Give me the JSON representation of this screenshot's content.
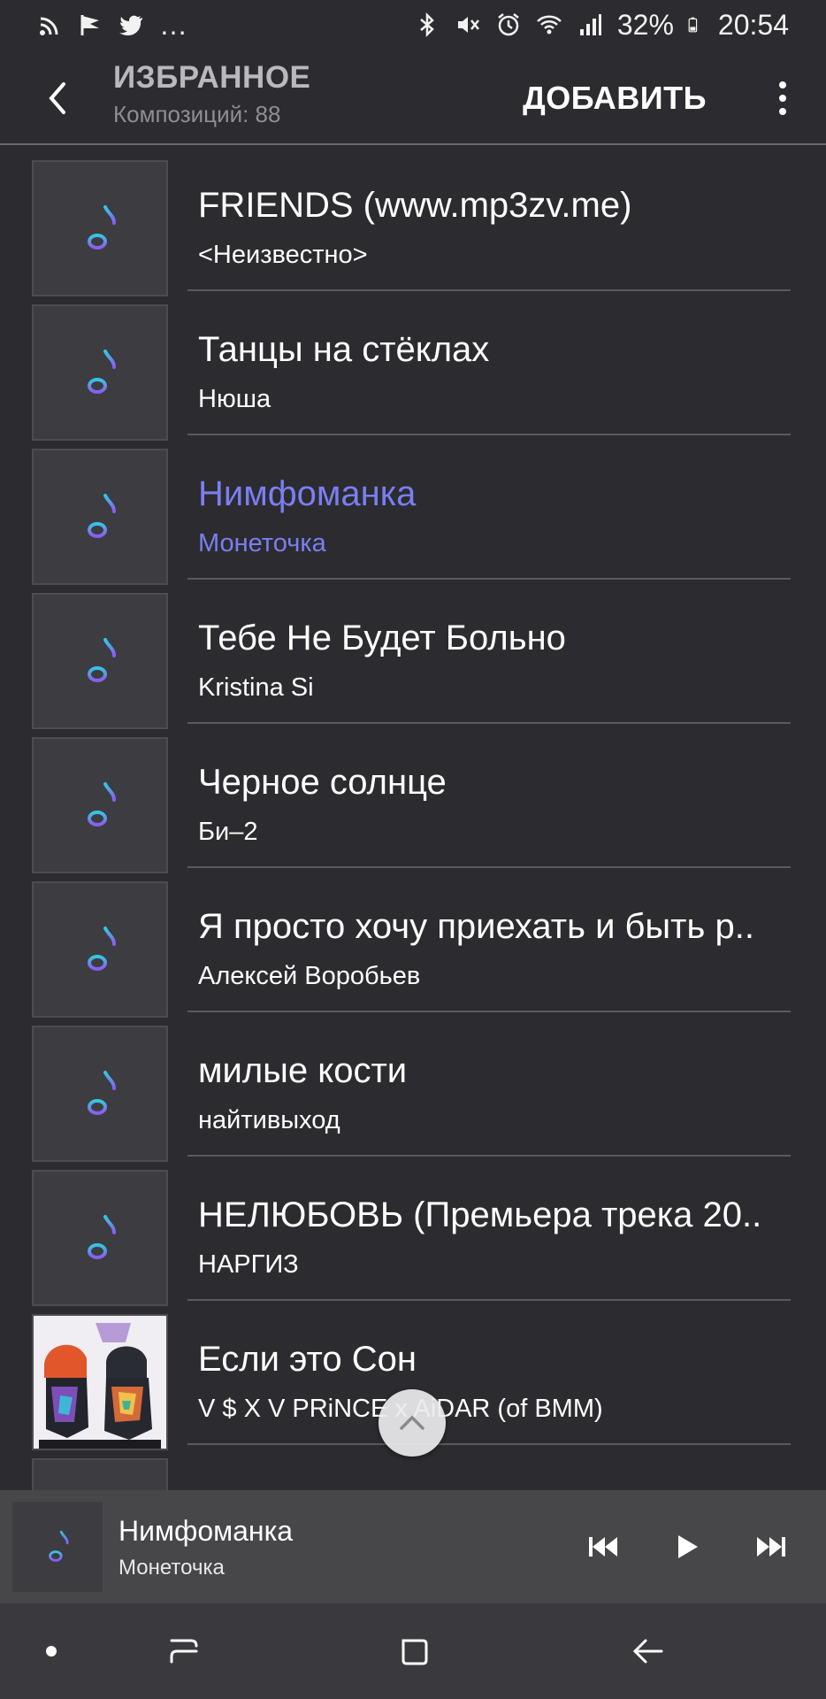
{
  "status_bar": {
    "left_icons": [
      "rss-icon",
      "flag-icon",
      "twitter-icon"
    ],
    "more_indicator": "…",
    "right_icons": [
      "bluetooth-icon",
      "mute-icon",
      "alarm-icon",
      "wifi-icon",
      "signal-icon"
    ],
    "battery": "32%",
    "time": "20:54"
  },
  "header": {
    "title": "ИЗБРАННОЕ",
    "subtitle": "Композиций: 88",
    "add_label": "ДОБАВИТЬ"
  },
  "tracks": [
    {
      "title": "FRIENDS (www.mp3zv.me)",
      "artist": "<Неизвестно>",
      "icon": "music-note-icon"
    },
    {
      "title": "Танцы на стёклах",
      "artist": "Нюша",
      "icon": "music-note-icon"
    },
    {
      "title": "Нимфоманка",
      "artist": "Монеточка",
      "icon": "music-note-icon",
      "active": true
    },
    {
      "title": "Тебе Не Будет Больно",
      "artist": "Kristina Si",
      "icon": "music-note-icon"
    },
    {
      "title": "Черное солнце",
      "artist": "Би–2",
      "icon": "music-note-icon"
    },
    {
      "title": "Я просто хочу приехать и быть р..",
      "artist": "Алексей Воробьев",
      "icon": "music-note-icon"
    },
    {
      "title": "милые кости",
      "artist": "найтивыход",
      "icon": "music-note-icon"
    },
    {
      "title": "НЕЛЮБОВЬ (Премьера трека 20..",
      "artist": "НАРГИЗ",
      "icon": "music-note-icon"
    },
    {
      "title": "Если это Сон",
      "artist": "V $ X V PRiNCE x AiDAR (of BMM)",
      "icon": "album-cover"
    }
  ],
  "now_playing": {
    "title": "Нимфоманка",
    "artist": "Монеточка"
  },
  "colors": {
    "background": "#2c2b2f",
    "accent": "#7b7ef2",
    "player_bar": "#474649",
    "nav_bar": "#3a393d"
  }
}
